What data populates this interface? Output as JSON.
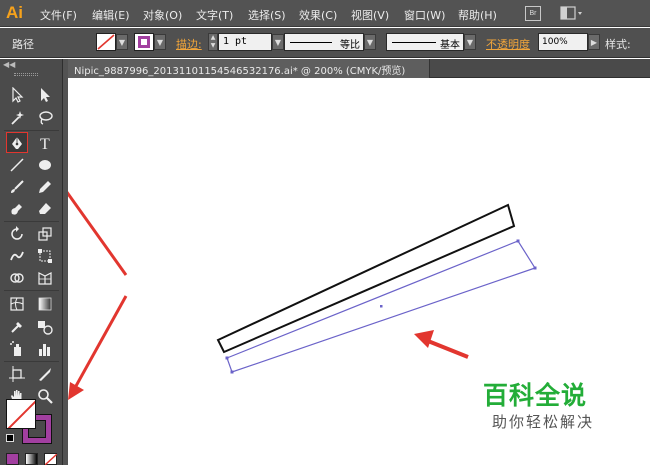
{
  "app": {
    "logo": "Ai"
  },
  "menu": {
    "items": [
      {
        "label": "文件(F)"
      },
      {
        "label": "编辑(E)"
      },
      {
        "label": "对象(O)"
      },
      {
        "label": "文字(T)"
      },
      {
        "label": "选择(S)"
      },
      {
        "label": "效果(C)"
      },
      {
        "label": "视图(V)"
      },
      {
        "label": "窗口(W)"
      },
      {
        "label": "帮助(H)"
      }
    ],
    "bridge_icon": "Br"
  },
  "control_bar": {
    "selection_label": "路径",
    "stroke_label": "描边:",
    "stroke_weight": "1 pt",
    "variable_width_label": "等比",
    "brush_label": "基本",
    "opacity_label": "不透明度",
    "opacity_value": "100%",
    "style_label": "样式:"
  },
  "document": {
    "tab_title": "Nipic_9887996_20131101154546532176.ai* @ 200% (CMYK/预览)"
  },
  "tools": [
    {
      "name": "selection-tool-icon"
    },
    {
      "name": "direct-selection-tool-icon"
    },
    {
      "name": "magic-wand-tool-icon"
    },
    {
      "name": "lasso-tool-icon"
    },
    {
      "name": "pen-tool-icon",
      "highlighted": true
    },
    {
      "name": "type-tool-icon",
      "glyph": "T"
    },
    {
      "name": "line-segment-tool-icon"
    },
    {
      "name": "ellipse-tool-icon"
    },
    {
      "name": "paintbrush-tool-icon"
    },
    {
      "name": "pencil-tool-icon"
    },
    {
      "name": "blob-brush-tool-icon"
    },
    {
      "name": "eraser-tool-icon"
    },
    {
      "name": "rotate-tool-icon"
    },
    {
      "name": "scale-tool-icon"
    },
    {
      "name": "warp-tool-icon"
    },
    {
      "name": "free-transform-tool-icon"
    },
    {
      "name": "shape-builder-tool-icon"
    },
    {
      "name": "perspective-grid-tool-icon"
    },
    {
      "name": "mesh-tool-icon"
    },
    {
      "name": "gradient-tool-icon"
    },
    {
      "name": "eyedropper-tool-icon"
    },
    {
      "name": "blend-tool-icon"
    },
    {
      "name": "symbol-sprayer-tool-icon"
    },
    {
      "name": "column-graph-tool-icon"
    },
    {
      "name": "artboard-tool-icon"
    },
    {
      "name": "slice-tool-icon"
    },
    {
      "name": "hand-tool-icon"
    },
    {
      "name": "zoom-tool-icon"
    }
  ],
  "colors": {
    "accent_orange": "#f7a21b",
    "annotation_red": "#e2362f",
    "selection_blue": "#6b63c9",
    "stroke_purple": "#a23fa0",
    "watermark_green": "#23ad38"
  },
  "watermark": {
    "title": "百科全说",
    "subtitle": "助你轻松解决"
  }
}
